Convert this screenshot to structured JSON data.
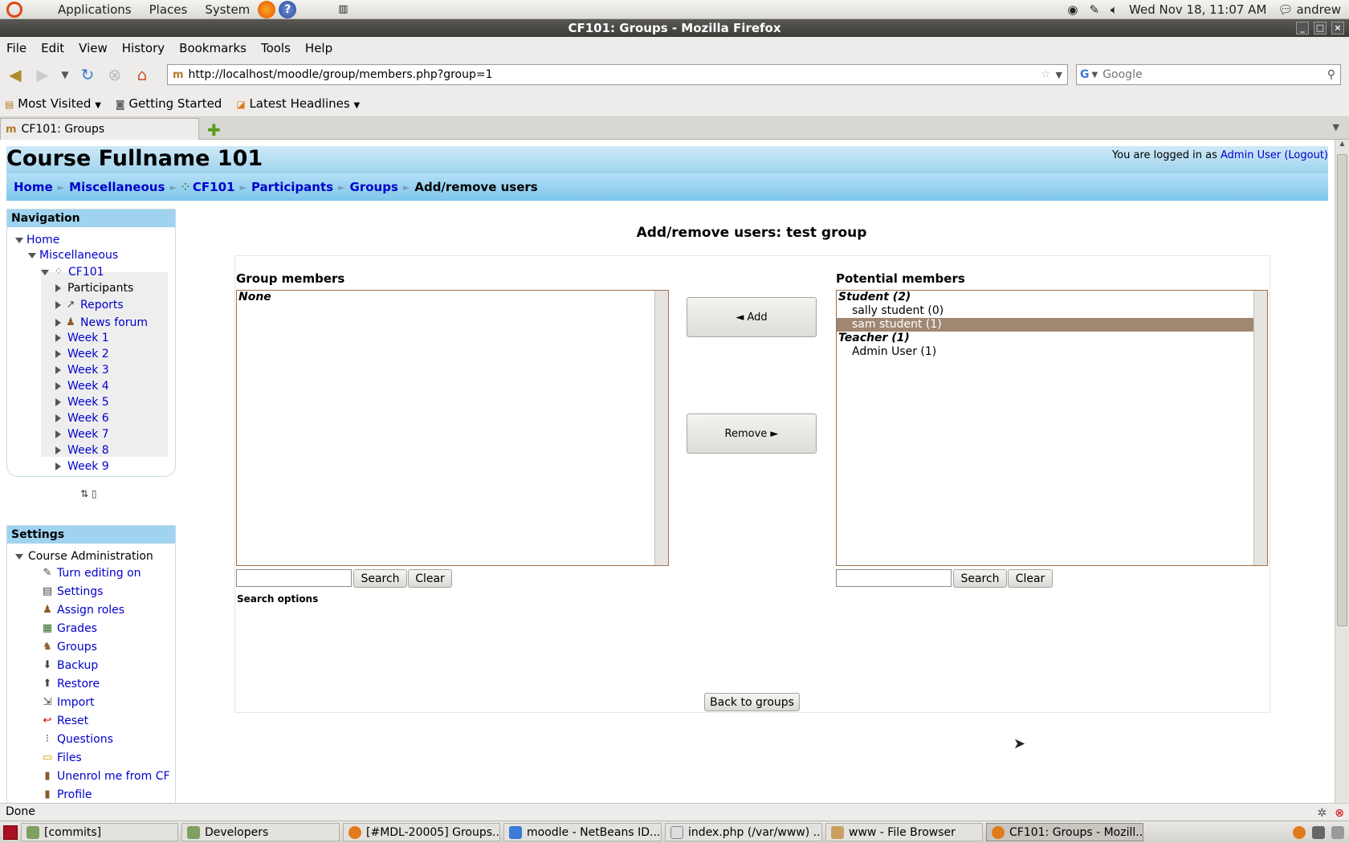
{
  "system_panel": {
    "menus": [
      "Applications",
      "Places",
      "System"
    ],
    "clock": "Wed Nov 18, 11:07 AM",
    "user": "andrew"
  },
  "window": {
    "title": "CF101: Groups - Mozilla Firefox"
  },
  "browser": {
    "menu": [
      "File",
      "Edit",
      "View",
      "History",
      "Bookmarks",
      "Tools",
      "Help"
    ],
    "url": "http://localhost/moodle/group/members.php?group=1",
    "search_placeholder": "Google",
    "bookmarks": [
      "Most Visited",
      "Getting Started",
      "Latest Headlines"
    ],
    "tab_title": "CF101: Groups",
    "status": "Done"
  },
  "page": {
    "course_title": "Course Fullname 101",
    "login": {
      "prefix": "You are logged in as ",
      "user": "Admin User",
      "logout": "(Logout)"
    },
    "breadcrumb": [
      "Home",
      "Miscellaneous",
      "CF101",
      "Participants",
      "Groups",
      "Add/remove users"
    ],
    "navigation": {
      "title": "Navigation",
      "home": "Home",
      "category": "Miscellaneous",
      "course": "CF101",
      "items": [
        "Participants",
        "Reports",
        "News forum",
        "Week 1",
        "Week 2",
        "Week 3",
        "Week 4",
        "Week 5",
        "Week 6",
        "Week 7",
        "Week 8",
        "Week 9"
      ]
    },
    "settings": {
      "title": "Settings",
      "section": "Course Administration",
      "items": [
        "Turn editing on",
        "Settings",
        "Assign roles",
        "Grades",
        "Groups",
        "Backup",
        "Restore",
        "Import",
        "Reset",
        "Questions",
        "Files",
        "Unenrol me from CF",
        "Profile"
      ]
    },
    "heading": "Add/remove users: test group",
    "group_members": {
      "label": "Group members",
      "empty": "None"
    },
    "potential_members": {
      "label": "Potential members",
      "groups": [
        {
          "name": "Student (2)",
          "members": [
            "sally student (0)",
            "sam student (1)"
          ]
        },
        {
          "name": "Teacher (1)",
          "members": [
            "Admin User (1)"
          ]
        }
      ],
      "selected": "sam student (1)"
    },
    "add_button": "◄ Add",
    "remove_button": "Remove ►",
    "search_button": "Search",
    "clear_button": "Clear",
    "search_options": "Search options",
    "back_button": "Back to groups"
  },
  "taskbar": [
    "[commits]",
    "Developers",
    "[#MDL-20005] Groups...",
    "moodle - NetBeans ID...",
    "index.php (/var/www) ...",
    "www - File Browser",
    "CF101: Groups - Mozill..."
  ]
}
